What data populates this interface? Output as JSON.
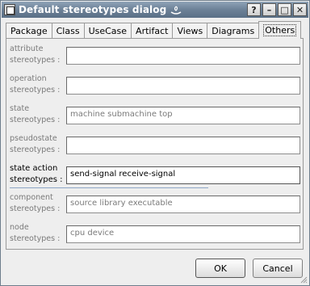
{
  "window": {
    "title": "Default stereotypes dialog"
  },
  "title_buttons": {
    "help": "?",
    "minimize": "–",
    "maximize": "□",
    "close": "✕"
  },
  "tabs": [
    {
      "label": "Package"
    },
    {
      "label": "Class"
    },
    {
      "label": "UseCase"
    },
    {
      "label": "Artifact"
    },
    {
      "label": "Views"
    },
    {
      "label": "Diagrams"
    },
    {
      "label": "Others",
      "active": true
    }
  ],
  "rows": [
    {
      "label_line1": "attribute",
      "label_line2": "stereotypes :",
      "value": ""
    },
    {
      "label_line1": "operation",
      "label_line2": "stereotypes :",
      "value": ""
    },
    {
      "label_line1": "state",
      "label_line2": "stereotypes :",
      "value": "machine submachine top"
    },
    {
      "label_line1": "pseudostate",
      "label_line2": "stereotypes :",
      "value": ""
    },
    {
      "label_line1": "state action",
      "label_line2": "stereotypes :",
      "value": "send-signal receive-signal"
    },
    {
      "label_line1": "component",
      "label_line2": "stereotypes :",
      "value": "source library executable"
    },
    {
      "label_line1": "node",
      "label_line2": "stereotypes :",
      "value": "cpu device"
    }
  ],
  "buttons": {
    "ok": "OK",
    "cancel": "Cancel"
  },
  "colors": {
    "titlebar": "#6c8197",
    "window_bg": "#eeeeee",
    "disabled_text": "#7a7a7a"
  }
}
